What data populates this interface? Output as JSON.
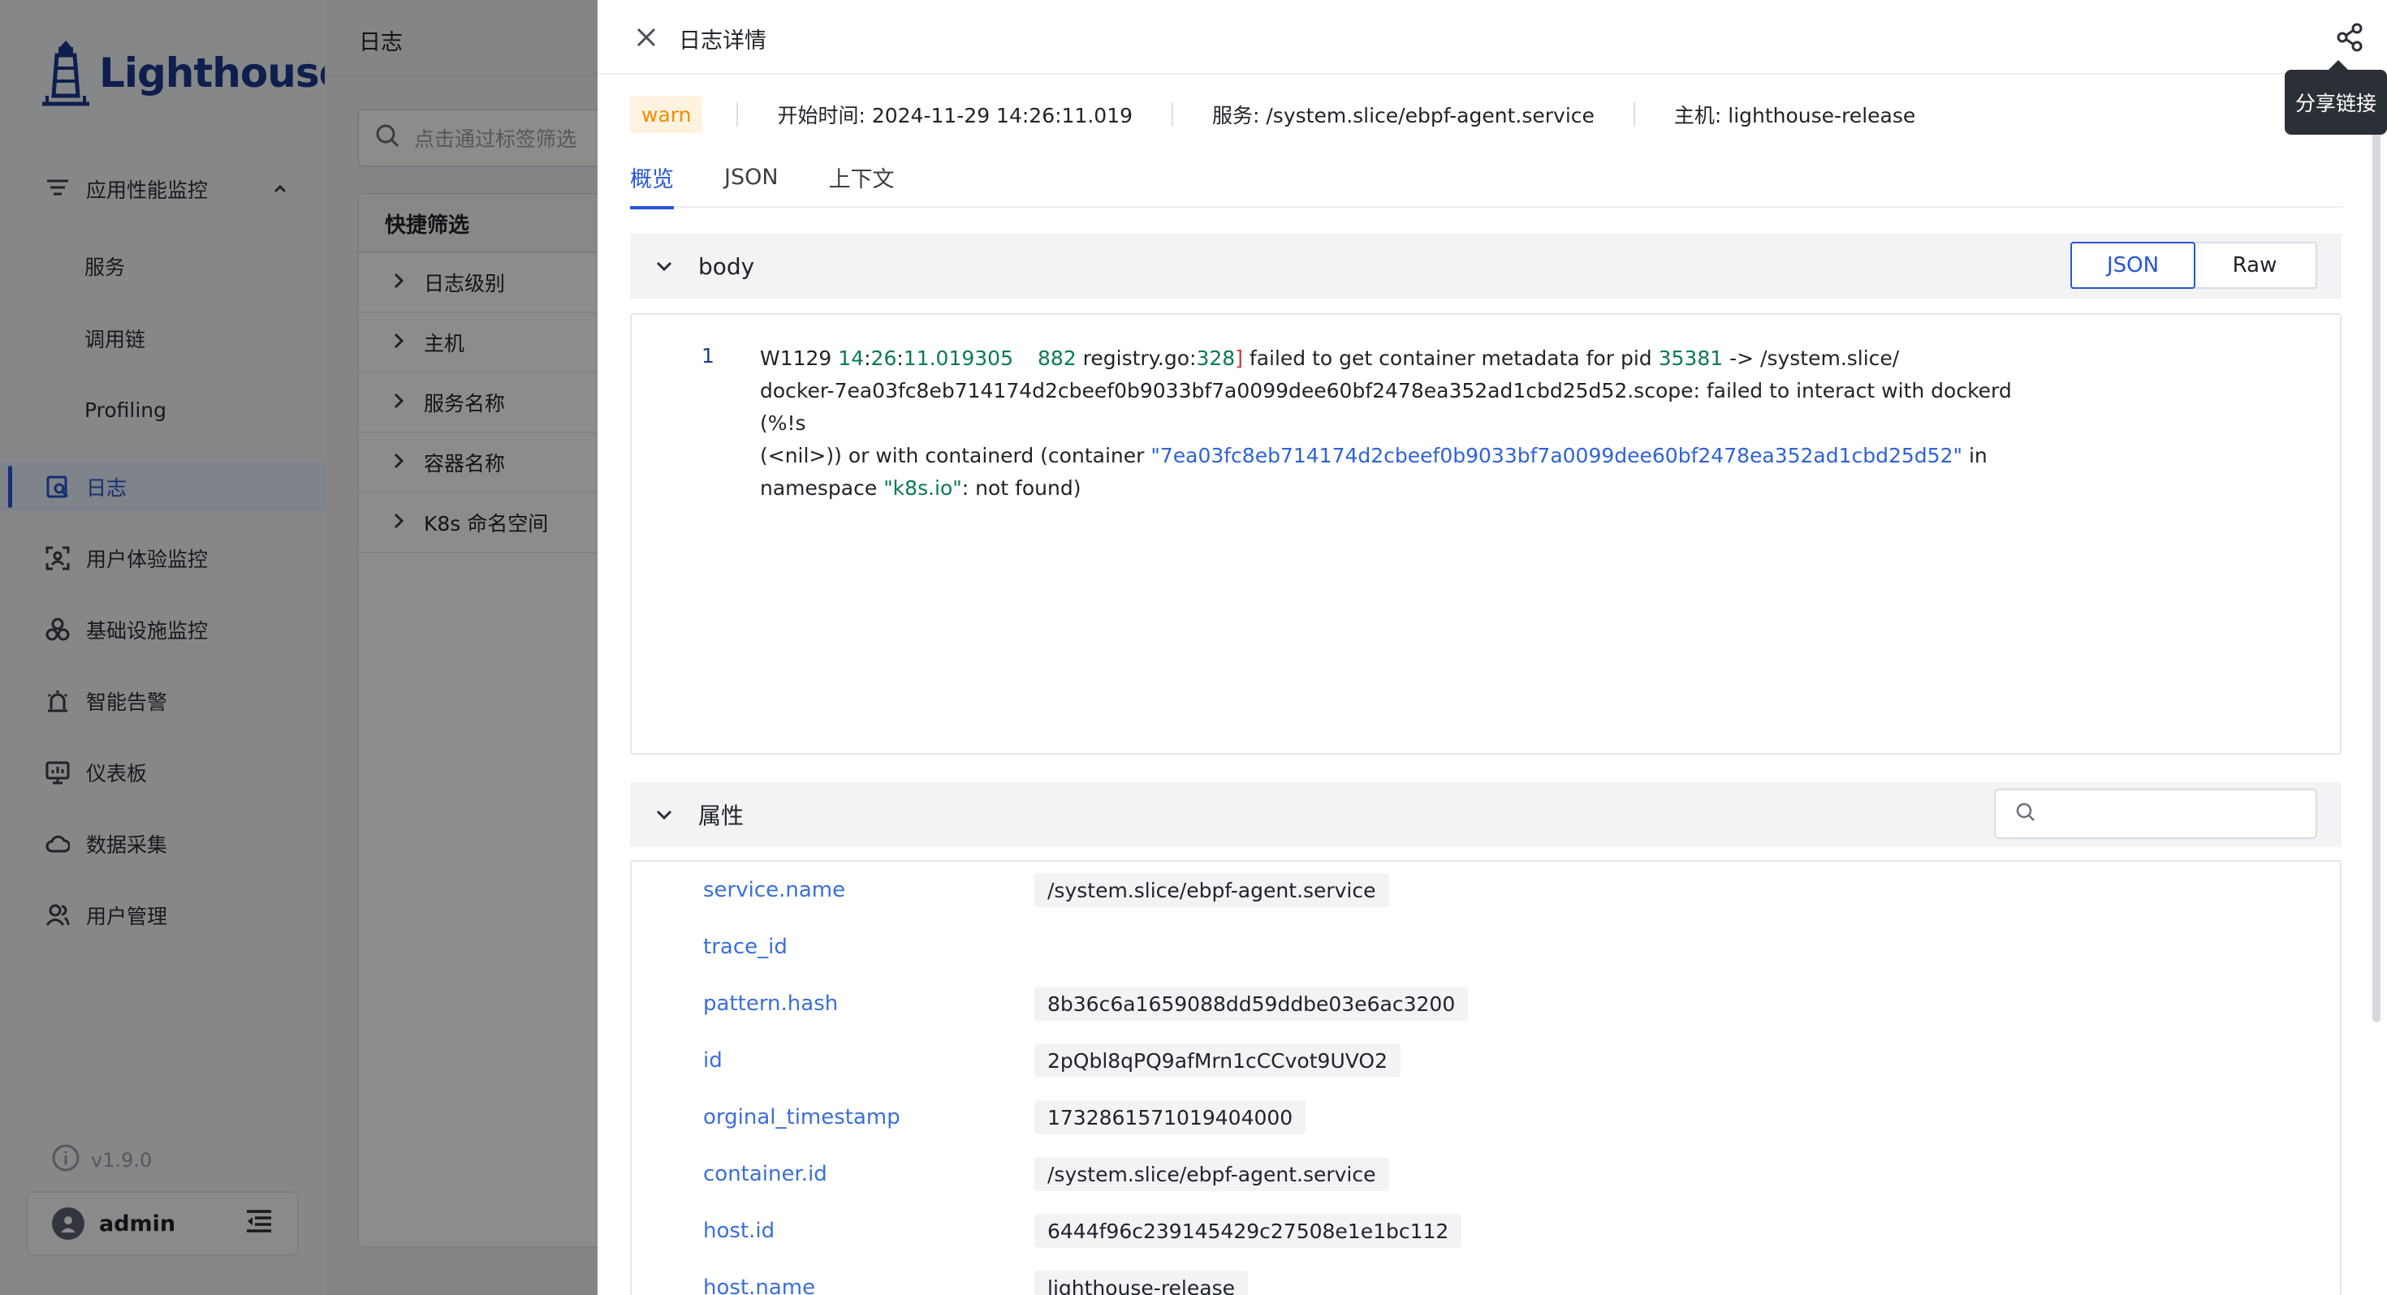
{
  "sidebar": {
    "logo_text": "Lighthouse",
    "apm_group": "应用性能监控",
    "apm_items": [
      "服务",
      "调用链",
      "Profiling"
    ],
    "items": [
      {
        "label": "日志",
        "icon": "log-search-icon",
        "active": true
      },
      {
        "label": "用户体验监控",
        "icon": "user-scan-icon"
      },
      {
        "label": "基础设施监控",
        "icon": "infrastructure-icon"
      },
      {
        "label": "智能告警",
        "icon": "alarm-icon"
      },
      {
        "label": "仪表板",
        "icon": "dashboard-icon"
      },
      {
        "label": "数据采集",
        "icon": "data-collect-icon"
      },
      {
        "label": "用户管理",
        "icon": "user-manage-icon"
      }
    ],
    "version": "v1.9.0",
    "username": "admin"
  },
  "page": {
    "title": "日志",
    "search_placeholder": "点击通过标签筛选",
    "quick_filter": {
      "title": "快捷筛选",
      "items": [
        "日志级别",
        "主机",
        "服务名称",
        "容器名称",
        "K8s 命名空间"
      ]
    }
  },
  "drawer": {
    "title": "日志详情",
    "share_tooltip": "分享链接",
    "level": "warn",
    "start_time": "开始时间: 2024-11-29 14:26:11.019",
    "service": "服务: /system.slice/ebpf-agent.service",
    "host": "主机: lighthouse-release",
    "tabs": [
      "概览",
      "JSON",
      "上下文"
    ],
    "active_tab": 0,
    "body_section": {
      "title": "body",
      "view_modes": [
        "JSON",
        "Raw"
      ],
      "active_mode": "JSON",
      "line_number": "1",
      "log_line": {
        "prefix": "W1129 ",
        "hour": "14",
        "colon1": ":",
        "minute": "26",
        "colon2": ":",
        "seconds": "11.019305",
        "pid": "882",
        "file": " registry.go:",
        "line": "328",
        "bracket": "]",
        "msg1": " failed to get container metadata for pid ",
        "target_pid": "35381",
        "msg2": " -> /system.slice/",
        "msg3": "docker-7ea03fc8eb714174d2cbeef0b9033bf7a0099dee60bf2478ea352ad1cbd25d52.scope: failed to interact with dockerd (%!s",
        "msg4": "(<nil>)) or with containerd (container ",
        "container_id": "\"7ea03fc8eb714174d2cbeef0b9033bf7a0099dee60bf2478ea352ad1cbd25d52\"",
        "msg5": " in",
        "msg6": "namespace ",
        "namespace": "\"k8s.io\"",
        "msg7": ": not found)"
      }
    },
    "attributes_section": {
      "title": "属性",
      "rows": [
        {
          "key": "service.name",
          "value": "/system.slice/ebpf-agent.service"
        },
        {
          "key": "trace_id",
          "value": ""
        },
        {
          "key": "pattern.hash",
          "value": "8b36c6a1659088dd59ddbe03e6ac3200"
        },
        {
          "key": "id",
          "value": "2pQbl8qPQ9afMrn1cCCvot9UVO2"
        },
        {
          "key": "orginal_timestamp",
          "value": "1732861571019404000"
        },
        {
          "key": "container.id",
          "value": "/system.slice/ebpf-agent.service"
        },
        {
          "key": "host.id",
          "value": "6444f96c239145429c27508e1e1bc112"
        },
        {
          "key": "host.name",
          "value": "lighthouse-release"
        }
      ]
    }
  },
  "colors": {
    "accent": "#2655d6",
    "warn_bg": "#fff3e0",
    "warn_text": "#f08c00",
    "attr_key": "#3b6fd8",
    "log_green": "#0b7a53",
    "log_red": "#d03434",
    "log_blue": "#2f62d7"
  }
}
